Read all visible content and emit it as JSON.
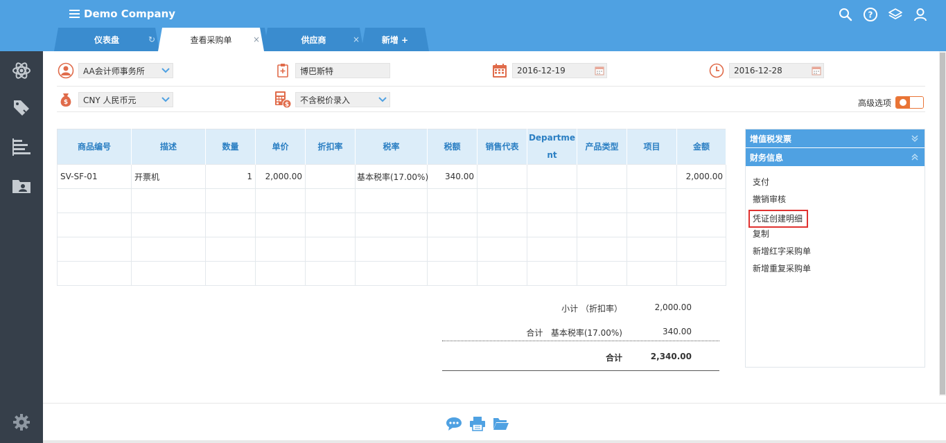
{
  "header": {
    "company": "Demo Company"
  },
  "tabs": [
    {
      "label": "仪表盘",
      "close": "↻"
    },
    {
      "label": "查看采购单",
      "close": "×"
    },
    {
      "label": "供应商",
      "close": "×"
    },
    {
      "label": "新增  +",
      "close": ""
    }
  ],
  "form": {
    "supplier": "AA会计师事务所",
    "contact": "博巴斯特",
    "date": "2016-12-19",
    "due_date": "2016-12-28",
    "currency": "CNY 人民币元",
    "tax_mode": "不含税价录入",
    "advanced_label": "高级选项"
  },
  "table": {
    "headers": [
      "商品编号",
      "描述",
      "数量",
      "单价",
      "折扣率",
      "税率",
      "税额",
      "销售代表",
      "Department",
      "产品类型",
      "项目",
      "金额"
    ],
    "rows": [
      [
        "SV-SF-01",
        "开票机",
        "1",
        "2,000.00",
        "",
        "基本税率(17.00%)",
        "340.00",
        "",
        "",
        "",
        "",
        "2,000.00"
      ]
    ]
  },
  "totals": {
    "subtotal_label": "小计 （折扣率）",
    "subtotal_value": "2,000.00",
    "tax_label": "合计   基本税率(17.00%)",
    "tax_value": "340.00",
    "total_label": "合计",
    "total_value": "2,340.00"
  },
  "right_panel": {
    "section1": "增值税发票",
    "section2": "财务信息",
    "items": [
      "支付",
      "撤销审核",
      "凭证创建明细",
      "复制",
      "新增红字采购单",
      "新增重复采购单"
    ]
  },
  "colors": {
    "header_blue": "#4fa1e2",
    "tab_blue": "#3a8ccf",
    "sidebar_dark": "#363f4a",
    "accent_orange": "#e97435",
    "highlight_red": "#e0312f"
  }
}
